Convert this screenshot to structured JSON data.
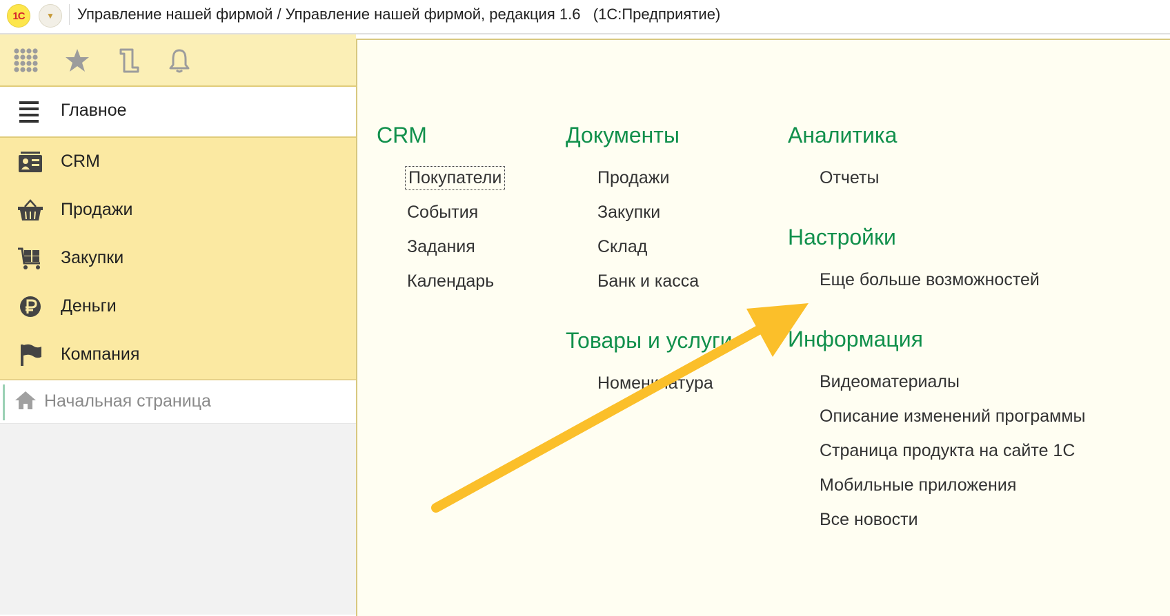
{
  "app": {
    "logo_text": "1С",
    "title": "Управление нашей фирмой / Управление нашей фирмой, редакция 1.6   (1С:Предприятие)"
  },
  "toolbar": {
    "icons": [
      "apps-grid-icon",
      "star-icon",
      "history-icon",
      "bell-icon"
    ]
  },
  "sidebar": {
    "main_label": "Главное",
    "items": [
      {
        "label": "CRM",
        "icon": "crm-card-icon"
      },
      {
        "label": "Продажи",
        "icon": "basket-icon"
      },
      {
        "label": "Закупки",
        "icon": "cart-icon"
      },
      {
        "label": "Деньги",
        "icon": "ruble-icon"
      },
      {
        "label": "Компания",
        "icon": "flag-icon"
      }
    ],
    "home_label": "Начальная страница"
  },
  "content": {
    "crm": {
      "title": "CRM",
      "links": [
        "Покупатели",
        "События",
        "Задания",
        "Календарь"
      ]
    },
    "documents": {
      "title": "Документы",
      "links": [
        "Продажи",
        "Закупки",
        "Склад",
        "Банк и касса"
      ]
    },
    "goods": {
      "title": "Товары и услуги",
      "links": [
        "Номенклатура"
      ]
    },
    "analytics": {
      "title": "Аналитика",
      "links": [
        "Отчеты"
      ]
    },
    "settings": {
      "title": "Настройки",
      "links": [
        "Еще больше возможностей"
      ]
    },
    "info": {
      "title": "Информация",
      "links": [
        "Видеоматериалы",
        "Описание изменений программы",
        "Страница продукта на сайте 1С",
        "Мобильные приложения",
        "Все новости"
      ]
    }
  },
  "colors": {
    "accent_green": "#11904c",
    "sidebar_yellow": "#fbe9a2",
    "arrow": "#fbbf2a"
  }
}
